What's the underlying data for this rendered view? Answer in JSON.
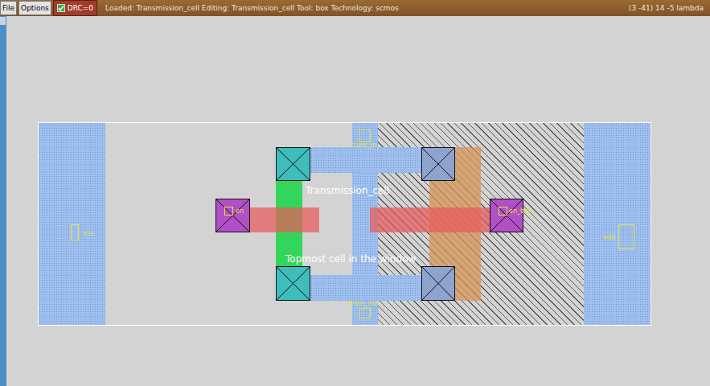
{
  "window": {
    "app": "Magic VLSI layout editor"
  },
  "toolbar": {
    "buttons": [
      "File",
      "Options"
    ],
    "drc": {
      "label": "DRC=0",
      "checked": true
    },
    "status": "Loaded: Transmission_cell Editing: Transmission_cell Tool: box  Technology: scmos",
    "coordinates": "(3 -41) 14 -5 lambda"
  },
  "canvas": {
    "cell_name": "Transmission_cell",
    "cell_note": "Topmost cell in the window",
    "labels": [
      {
        "text": "vss"
      },
      {
        "text": "vdd"
      },
      {
        "text": "en"
      },
      {
        "text": "en_bar"
      },
      {
        "text": "trans_in"
      },
      {
        "text": "trans_out"
      }
    ]
  }
}
